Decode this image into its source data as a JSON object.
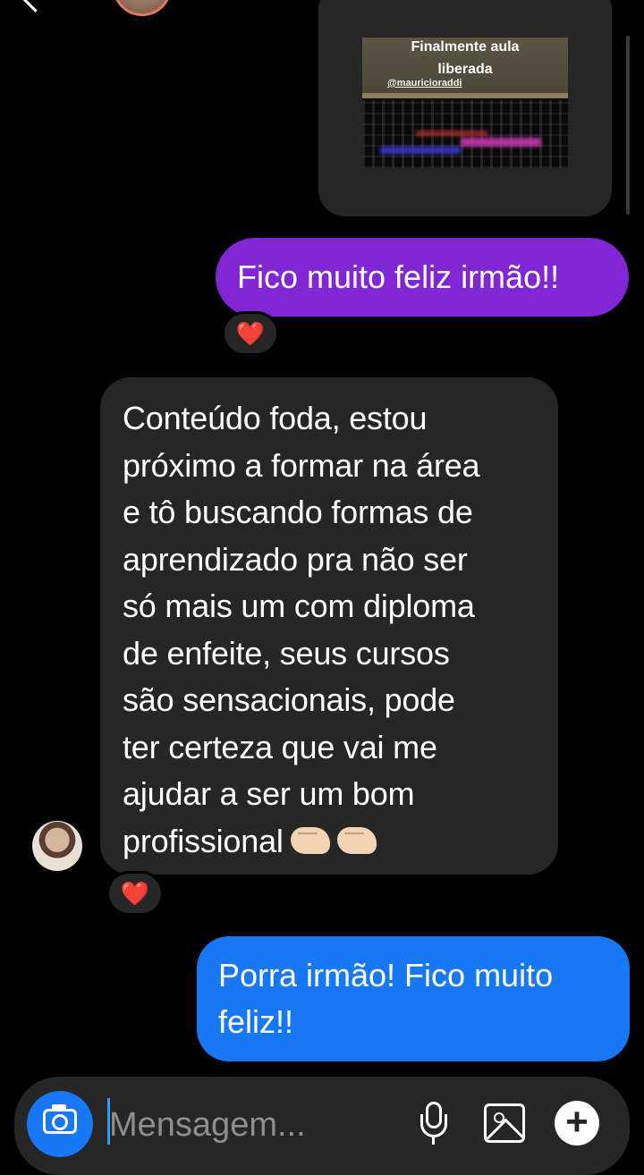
{
  "header": {
    "back_icon": "chevron-left-icon",
    "video_icon": "video-camera-icon",
    "phone_icon": "phone-icon",
    "info_icon": "info-icon"
  },
  "story_reply": {
    "title": "Finalmente aula\nliberada",
    "handle": "@mauricioraddi"
  },
  "messages": [
    {
      "direction": "outgoing",
      "text": "Fico muito feliz irmão!!",
      "color": "#8126d3",
      "reaction": "❤️"
    },
    {
      "direction": "incoming",
      "lines": [
        "Conteúdo foda, estou",
        "próximo a formar na área",
        "e tô buscando formas de",
        "aprendizado pra não ser",
        "só mais um com diploma",
        "de enfeite, seus cursos",
        "são sensacionais, pode",
        "ter certeza que vai me",
        "ajudar a ser um bom",
        "profissional"
      ],
      "emoji": "🤜🤛",
      "color": "#262626",
      "reaction": "❤️"
    },
    {
      "direction": "outgoing",
      "text": "Porra irmão! Fico muito feliz!!",
      "color": "#1877f2"
    }
  ],
  "composer": {
    "placeholder": "Mensagem...",
    "camera_icon": "camera-icon",
    "mic_icon": "microphone-icon",
    "gallery_icon": "gallery-icon",
    "plus_icon": "plus-icon"
  }
}
